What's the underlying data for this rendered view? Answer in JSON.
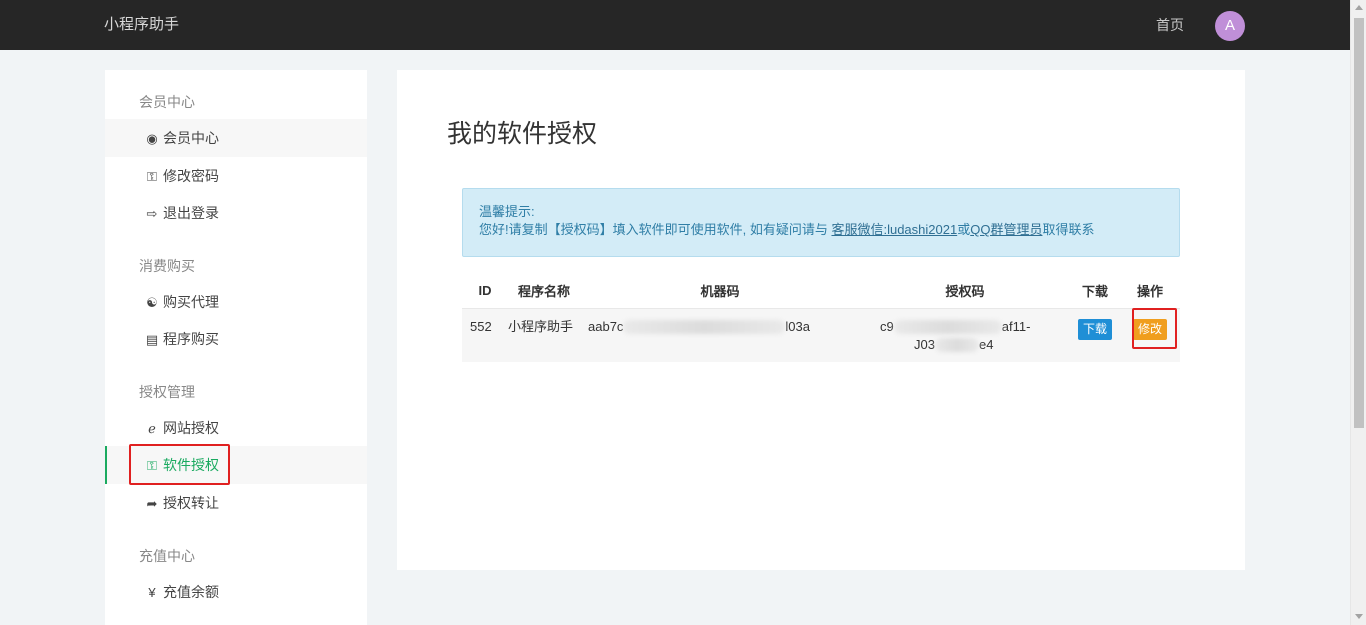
{
  "header": {
    "brand": "小程序助手",
    "home": "首页",
    "avatar_letter": "A"
  },
  "sidebar": {
    "groups": [
      {
        "title": "会员中心",
        "items": [
          {
            "label": "会员中心",
            "icon": "user-circle-icon"
          },
          {
            "label": "修改密码",
            "icon": "key-icon"
          },
          {
            "label": "退出登录",
            "icon": "sign-out-icon"
          }
        ]
      },
      {
        "title": "消费购买",
        "items": [
          {
            "label": "购买代理",
            "icon": "handshake-icon"
          },
          {
            "label": "程序购买",
            "icon": "paypal-card-icon"
          }
        ]
      },
      {
        "title": "授权管理",
        "items": [
          {
            "label": "网站授权",
            "icon": "ie-browser-icon"
          },
          {
            "label": "软件授权",
            "icon": "key-icon"
          },
          {
            "label": "授权转让",
            "icon": "share-arrow-icon"
          }
        ]
      },
      {
        "title": "充值中心",
        "items": [
          {
            "label": "充值余额",
            "icon": "yen-icon"
          }
        ]
      }
    ]
  },
  "main": {
    "title": "我的软件授权",
    "notice": {
      "line1": "温馨提示:",
      "line2_prefix": "您好!请复制【授权码】填入软件即可使用软件, 如有疑问请与",
      "link1": "客服微信:ludashi2021",
      "mid": "或",
      "link2": "QQ群管理员",
      "suffix": "取得联系"
    },
    "table": {
      "headers": [
        "ID",
        "程序名称",
        "机器码",
        "授权码",
        "下载",
        "操作"
      ],
      "rows": [
        {
          "id": "552",
          "name": "小程序助手",
          "machine_prefix": "aab7c",
          "machine_suffix": "l03a",
          "auth_prefix": "c9",
          "auth_suffix": "af11-",
          "auth_line2_prefix": "J03",
          "auth_line2_suffix": "e4",
          "download": "下载",
          "edit": "修改"
        }
      ]
    }
  }
}
